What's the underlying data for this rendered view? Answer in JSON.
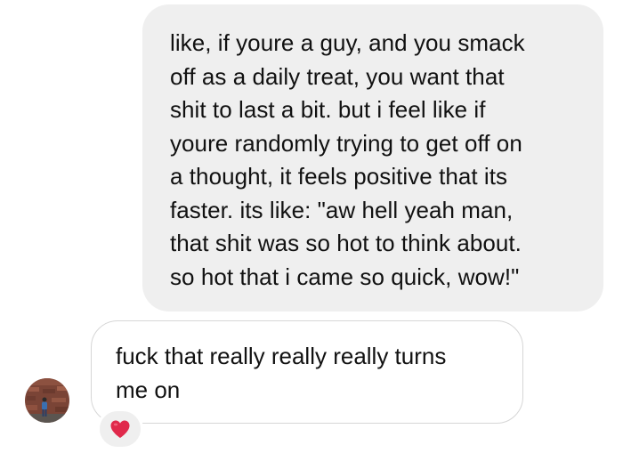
{
  "thread": {
    "sent_message": {
      "text": "like, if youre a guy, and you smack\noff as a daily treat, you want that\nshit to last a bit. but i feel like if\nyoure randomly trying to get off on\na thought, it feels positive that its\nfaster. its like: \"aw hell yeah man,\nthat shit was so hot to think about.\nso hot that i came so quick, wow!\""
    },
    "received_message": {
      "text": "fuck that really really really turns\nme on",
      "reaction": "heart-icon"
    }
  },
  "colors": {
    "sent_bubble": "#efefef",
    "received_border": "#d6d6d6",
    "reaction_heart": "#e0294b"
  }
}
